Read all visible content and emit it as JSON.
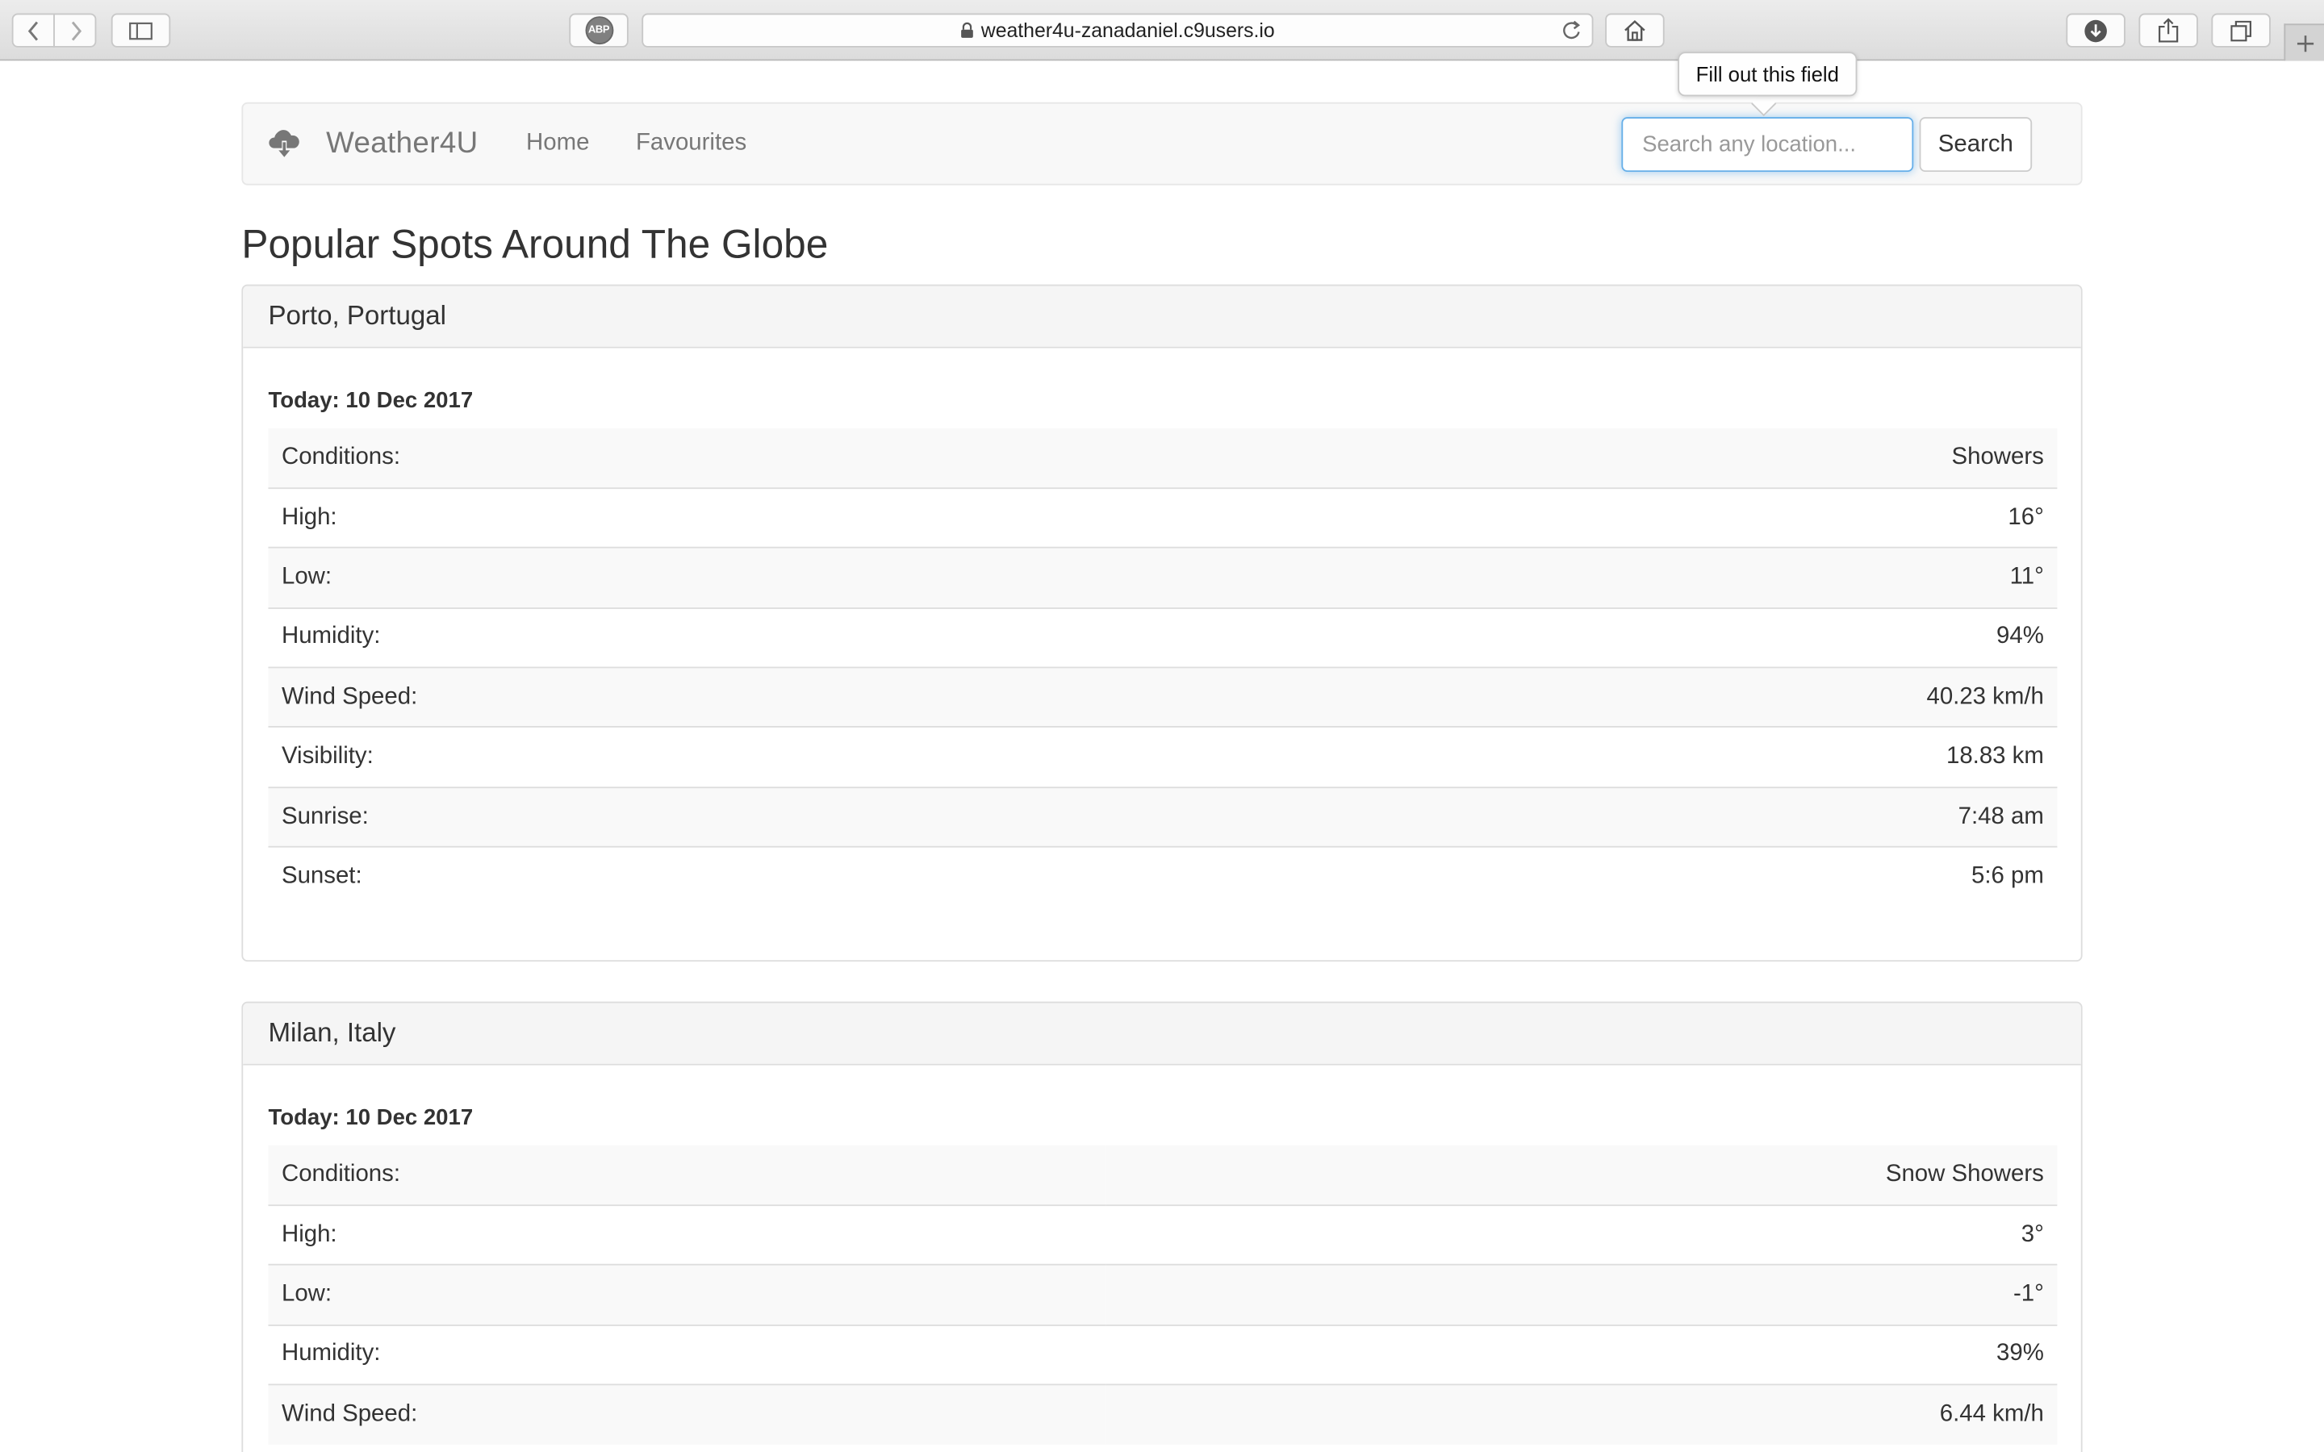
{
  "browser": {
    "url": "weather4u-zanadaniel.c9users.io",
    "adblock_badge": "ABP"
  },
  "navbar": {
    "brand": "Weather4U",
    "links": [
      "Home",
      "Favourites"
    ],
    "search_placeholder": "Search any location...",
    "search_button": "Search",
    "validation_tooltip": "Fill out this field"
  },
  "page": {
    "heading": "Popular Spots Around The Globe",
    "locations": [
      {
        "name": "Porto, Portugal",
        "date": "Today: 10 Dec 2017",
        "rows": [
          {
            "label": "Conditions:",
            "value": "Showers"
          },
          {
            "label": "High:",
            "value": "16°"
          },
          {
            "label": "Low:",
            "value": "11°"
          },
          {
            "label": "Humidity:",
            "value": "94%"
          },
          {
            "label": "Wind Speed:",
            "value": "40.23 km/h"
          },
          {
            "label": "Visibility:",
            "value": "18.83 km"
          },
          {
            "label": "Sunrise:",
            "value": "7:48 am"
          },
          {
            "label": "Sunset:",
            "value": "5:6 pm"
          }
        ]
      },
      {
        "name": "Milan, Italy",
        "date": "Today: 10 Dec 2017",
        "rows": [
          {
            "label": "Conditions:",
            "value": "Snow Showers"
          },
          {
            "label": "High:",
            "value": "3°"
          },
          {
            "label": "Low:",
            "value": "-1°"
          },
          {
            "label": "Humidity:",
            "value": "39%"
          },
          {
            "label": "Wind Speed:",
            "value": "6.44 km/h"
          }
        ]
      }
    ]
  },
  "colors": {
    "input_focus": "#66afe9",
    "navbar_bg": "#f8f8f8",
    "panel_heading_bg": "#f5f5f5",
    "striped_row": "#f9f9f9",
    "text": "#333333",
    "muted": "#777777"
  }
}
